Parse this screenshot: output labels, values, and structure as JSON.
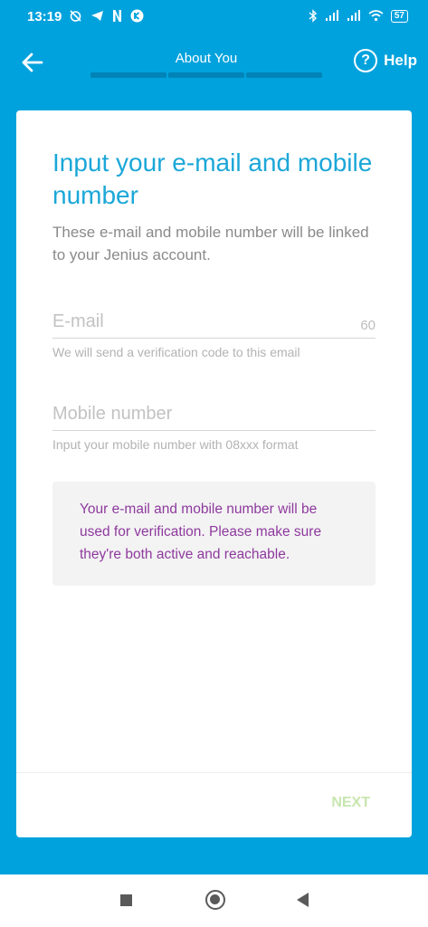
{
  "status_bar": {
    "time": "13:19",
    "battery": "57"
  },
  "header": {
    "title": "About You",
    "help_label": "Help",
    "progress_segments": 3,
    "progress_completed": 0
  },
  "form": {
    "heading": "Input your e-mail and mobile number",
    "subtitle": "These e-mail and mobile number will be linked to your Jenius account.",
    "email": {
      "placeholder": "E-mail",
      "value": "",
      "counter": "60",
      "helper": "We will send a verification code to this email"
    },
    "mobile": {
      "placeholder": "Mobile number",
      "value": "",
      "helper": "Input your mobile number with 08xxx format"
    },
    "info": "Your e-mail and mobile number will be used for verification. Please make sure they're both active and reachable."
  },
  "footer": {
    "next_label": "NEXT"
  },
  "colors": {
    "primary": "#00a2dd",
    "heading": "#1ba7d8",
    "info_text": "#8e3a9e",
    "next_disabled": "#c8e6b0"
  },
  "icons": {
    "back": "arrow-left-icon",
    "help": "question-circle-icon",
    "nav_recent": "square-icon",
    "nav_home": "circle-icon",
    "nav_back": "triangle-back-icon"
  }
}
